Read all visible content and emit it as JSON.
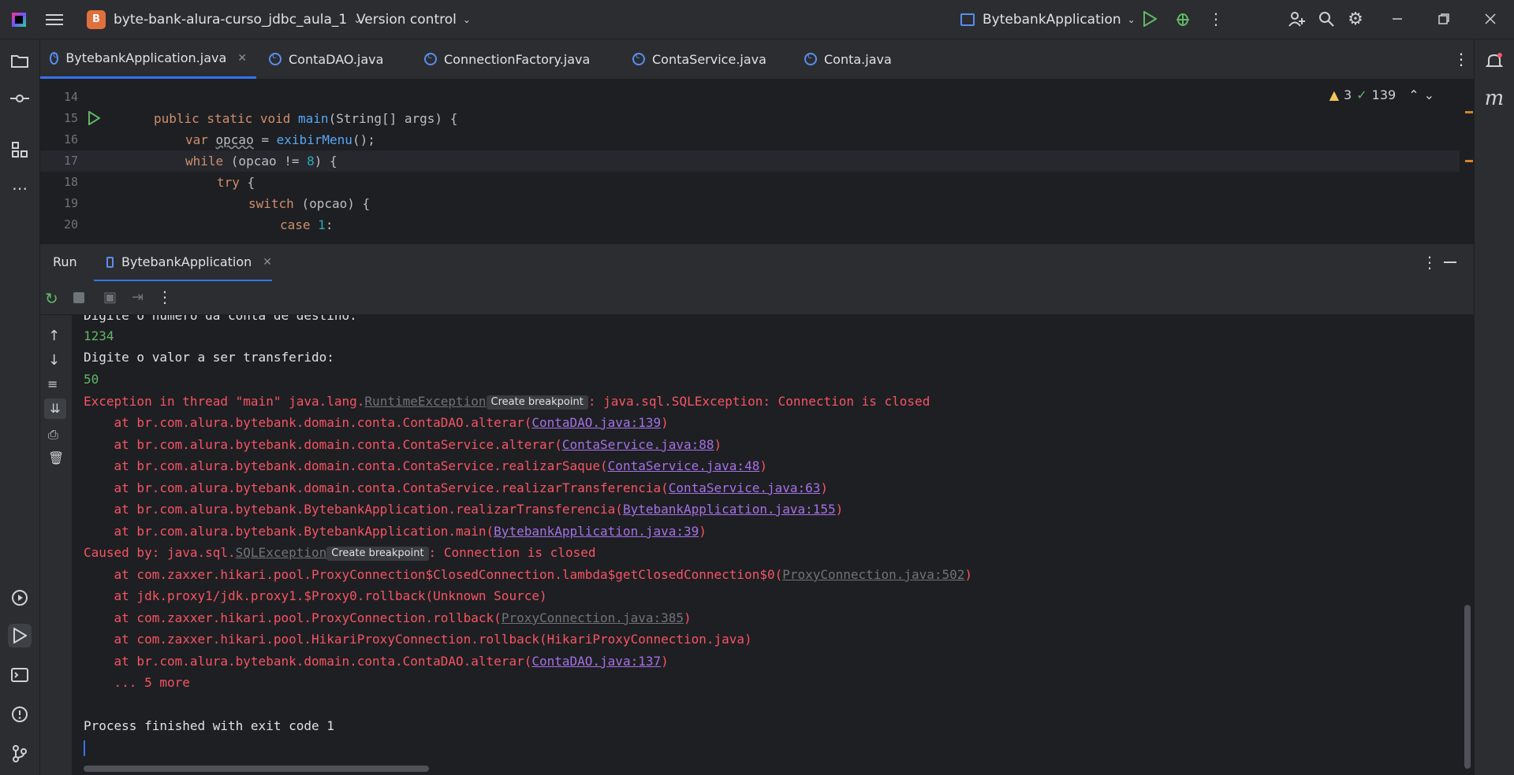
{
  "titlebar": {
    "project_badge": "B",
    "project_name": "byte-bank-alura-curso_jdbc_aula_1",
    "vcs": "Version control",
    "run_config": "BytebankApplication"
  },
  "tabs": [
    {
      "label": "BytebankApplication.java"
    },
    {
      "label": "ContaDAO.java"
    },
    {
      "label": "ConnectionFactory.java"
    },
    {
      "label": "ContaService.java"
    },
    {
      "label": "Conta.java"
    }
  ],
  "editor": {
    "warnings": "3",
    "ok_count": "139",
    "lines": [
      {
        "n": "14"
      },
      {
        "n": "15"
      },
      {
        "n": "16"
      },
      {
        "n": "17"
      },
      {
        "n": "18"
      },
      {
        "n": "19"
      },
      {
        "n": "20"
      }
    ]
  },
  "run_panel": {
    "title": "Run",
    "tab": "BytebankApplication"
  },
  "console": {
    "l0": "Digite o número da conta de destino:",
    "l1": "1234",
    "l2": "Digite o valor a ser transferido:",
    "l3": "50",
    "ex_prefix": "Exception in thread \"main\" java.lang.",
    "ex_class": "RuntimeException",
    "bp_label": "Create breakpoint",
    "ex_msg": ": java.sql.SQLException: Connection is closed",
    "at1": "    at br.com.alura.bytebank.domain.conta.ContaDAO.alterar(",
    "at1_link": "ContaDAO.java:139",
    "at2": "    at br.com.alura.bytebank.domain.conta.ContaService.alterar(",
    "at2_link": "ContaService.java:88",
    "at3": "    at br.com.alura.bytebank.domain.conta.ContaService.realizarSaque(",
    "at3_link": "ContaService.java:48",
    "at4": "    at br.com.alura.bytebank.domain.conta.ContaService.realizarTransferencia(",
    "at4_link": "ContaService.java:63",
    "at5": "    at br.com.alura.bytebank.BytebankApplication.realizarTransferencia(",
    "at5_link": "BytebankApplication.java:155",
    "at6": "    at br.com.alura.bytebank.BytebankApplication.main(",
    "at6_link": "BytebankApplication.java:39",
    "cause_prefix": "Caused by: java.sql.",
    "cause_class": "SQLException",
    "cause_msg": ": Connection is closed",
    "c1": "    at com.zaxxer.hikari.pool.ProxyConnection$ClosedConnection.lambda$getClosedConnection$0(",
    "c1_link": "ProxyConnection.java:502",
    "c2": "    at jdk.proxy1/jdk.proxy1.$Proxy0.rollback(Unknown Source)",
    "c3": "    at com.zaxxer.hikari.pool.ProxyConnection.rollback(",
    "c3_link": "ProxyConnection.java:385",
    "c4": "    at com.zaxxer.hikari.pool.HikariProxyConnection.rollback(HikariProxyConnection.java)",
    "c5": "    at br.com.alura.bytebank.domain.conta.ContaDAO.alterar(",
    "c5_link": "ContaDAO.java:137",
    "c6": "    ... 5 more",
    "finish": "Process finished with exit code 1"
  }
}
